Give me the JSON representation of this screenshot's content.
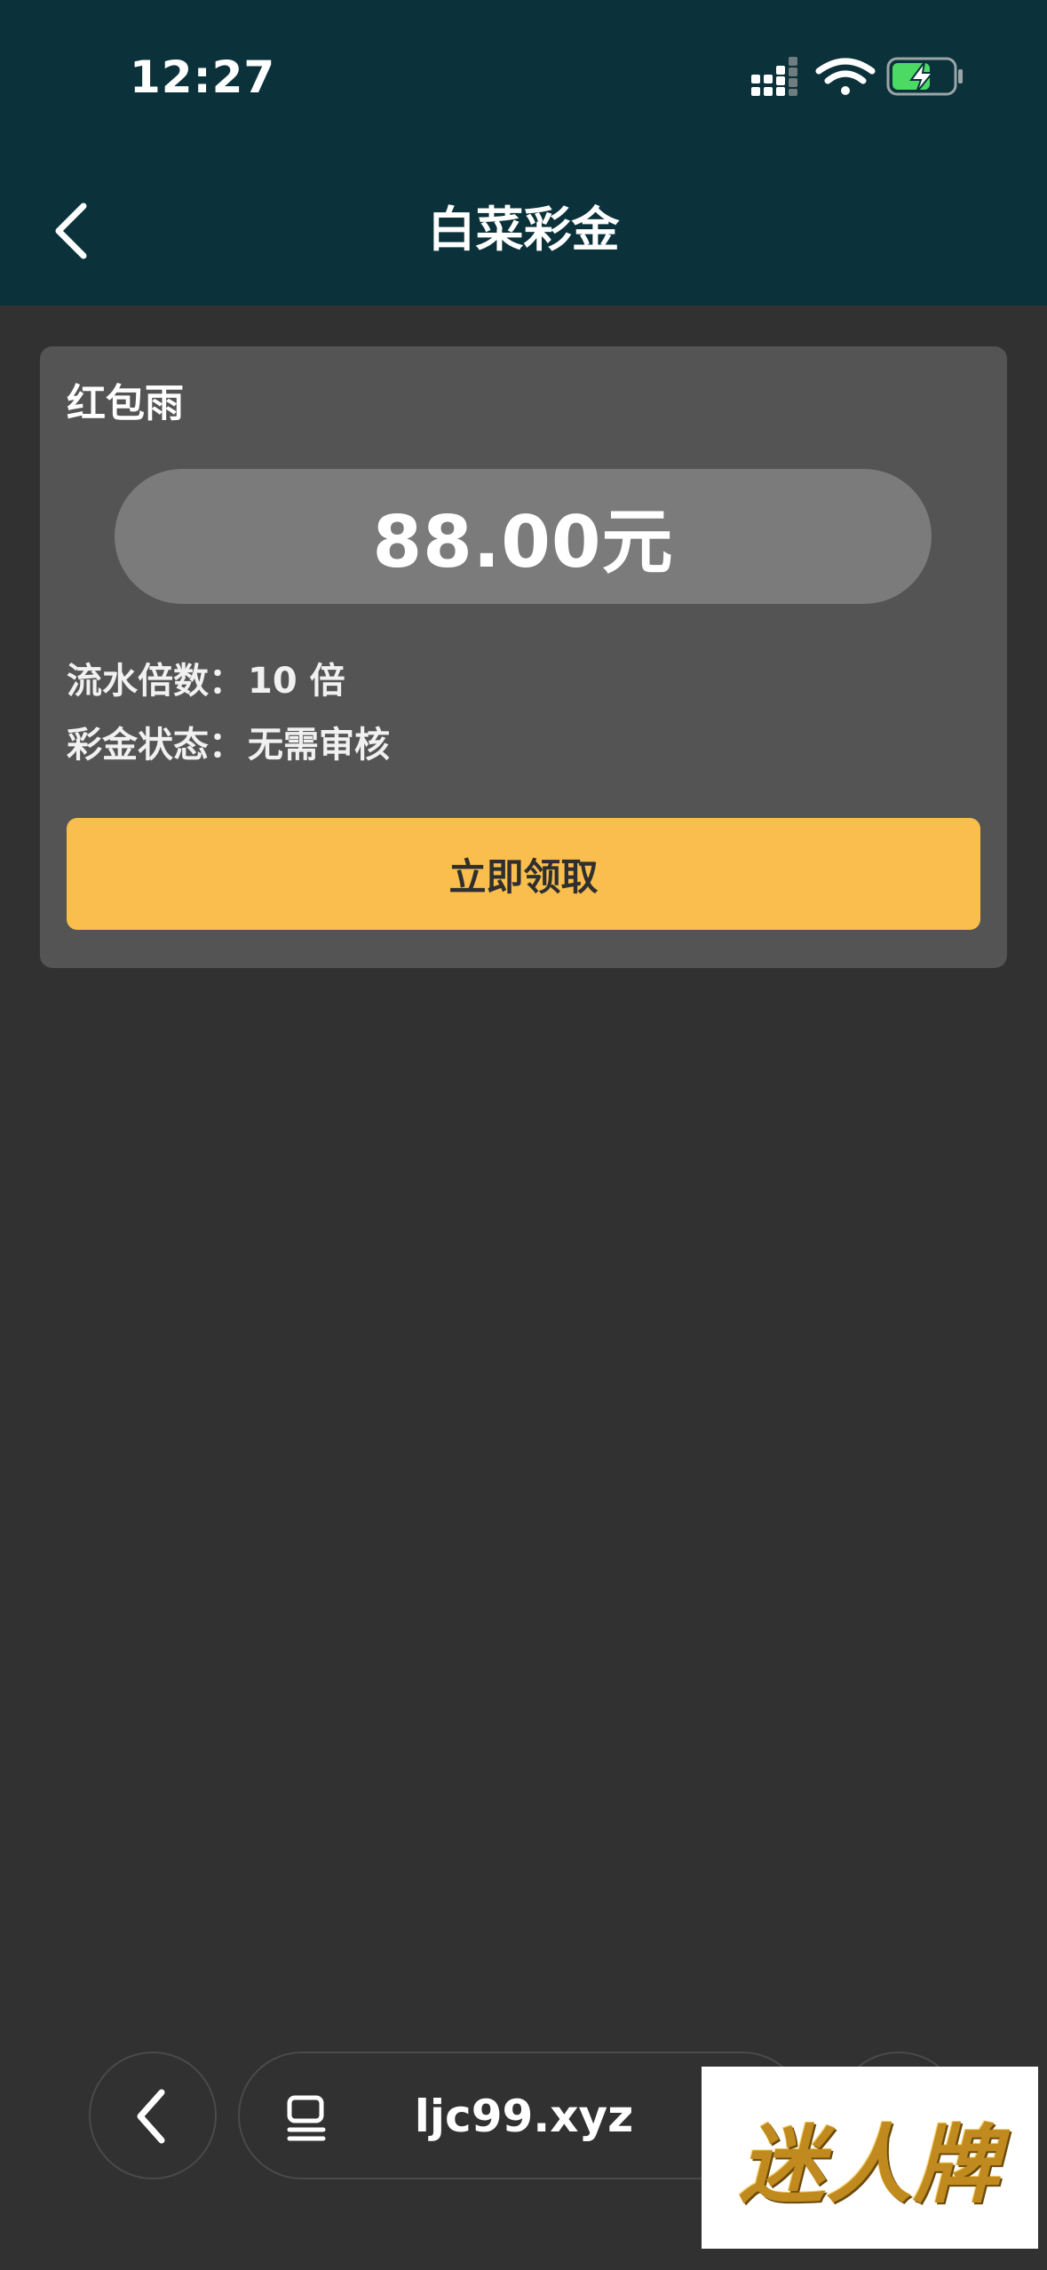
{
  "status_bar": {
    "time": "12:27",
    "signal_icon": "cellular-signal-icon",
    "wifi_icon": "wifi-icon",
    "battery_icon": "battery-charging-icon",
    "battery_color": "#4cd964"
  },
  "header": {
    "title": "白菜彩金",
    "back_icon": "chevron-left-icon",
    "background": "#0b323a"
  },
  "card": {
    "title": "红包雨",
    "amount": "88.00元",
    "rows": [
      {
        "label": "流水倍数：",
        "value": "10 倍"
      },
      {
        "label": "彩金状态：",
        "value": "无需审核"
      }
    ],
    "claim_label": "立即领取",
    "claim_color": "#f9be4d"
  },
  "browser_bar": {
    "back_icon": "chevron-left-icon",
    "tab_icon": "tabs-icon",
    "url": "ljc99.xyz"
  },
  "watermark": {
    "text": "迷人牌"
  }
}
